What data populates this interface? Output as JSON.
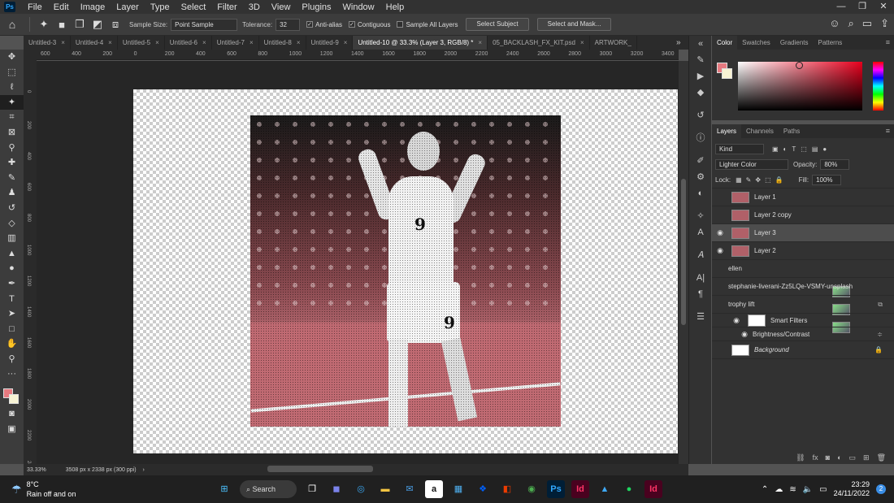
{
  "menu": [
    "File",
    "Edit",
    "Image",
    "Layer",
    "Type",
    "Select",
    "Filter",
    "3D",
    "View",
    "Plugins",
    "Window",
    "Help"
  ],
  "options": {
    "sample_size_label": "Sample Size:",
    "sample_size_value": "Point Sample",
    "tolerance_label": "Tolerance:",
    "tolerance_value": "32",
    "anti_alias": "Anti-alias",
    "contiguous": "Contiguous",
    "sample_all_layers": "Sample All Layers",
    "select_subject": "Select Subject",
    "select_and_mask": "Select and Mask..."
  },
  "tabs": [
    {
      "label": "Untitled-3",
      "active": false
    },
    {
      "label": "Untitled-4",
      "active": false
    },
    {
      "label": "Untitled-5",
      "active": false
    },
    {
      "label": "Untitled-6",
      "active": false
    },
    {
      "label": "Untitled-7",
      "active": false
    },
    {
      "label": "Untitled-8",
      "active": false
    },
    {
      "label": "Untitled-9",
      "active": false
    },
    {
      "label": "Untitled-10 @ 33.3% (Layer 3, RGB/8) *",
      "active": true
    },
    {
      "label": "05_BACKLASH_FX_KIT.psd",
      "active": false
    },
    {
      "label": "ARTWORK_",
      "active": false
    }
  ],
  "ruler_top": [
    "600",
    "400",
    "200",
    "0",
    "200",
    "400",
    "600",
    "800",
    "1000",
    "1200",
    "1400",
    "1600",
    "1800",
    "2000",
    "2200",
    "2400",
    "2600",
    "2800",
    "3000",
    "3200",
    "3400"
  ],
  "ruler_left": [
    "0",
    "200",
    "400",
    "600",
    "800",
    "1000",
    "1200",
    "1400",
    "1600",
    "1800",
    "2000",
    "2200",
    "2400"
  ],
  "color_panel": {
    "tabs": [
      "Color",
      "Swatches",
      "Gradients",
      "Patterns"
    ],
    "foreground": "#e67a80",
    "background": "#f7f3d4"
  },
  "layers_panel": {
    "tabs": [
      "Layers",
      "Channels",
      "Paths"
    ],
    "filter_kind": "Kind",
    "blend_mode": "Lighter Color",
    "opacity_label": "Opacity:",
    "opacity_value": "80%",
    "lock_label": "Lock:",
    "fill_label": "Fill:",
    "fill_value": "100%",
    "layers": [
      {
        "name": "Layer 1",
        "visible": false,
        "selected": false
      },
      {
        "name": "Layer 2 copy",
        "visible": false,
        "selected": false
      },
      {
        "name": "Layer 3",
        "visible": true,
        "selected": true
      },
      {
        "name": "Layer 2",
        "visible": true,
        "selected": false
      },
      {
        "name": "ellen",
        "visible": false,
        "selected": false
      },
      {
        "name": "stephanie-liverani-Zz5LQe-VSMY-unsplash",
        "visible": false,
        "selected": false
      },
      {
        "name": "trophy lift",
        "visible": false,
        "selected": false
      }
    ],
    "smart_filters": "Smart Filters",
    "brightness_contrast": "Brightness/Contrast",
    "background_layer": "Background"
  },
  "status": {
    "zoom": "33.33%",
    "doc_info": "3508 px x 2338 px (300 ppi)"
  },
  "canvas": {
    "jersey_number": "9"
  },
  "taskbar": {
    "temp": "8°C",
    "weather": "Rain off and on",
    "search": "Search",
    "time": "23:29",
    "date": "24/11/2022",
    "notifications": "2"
  }
}
